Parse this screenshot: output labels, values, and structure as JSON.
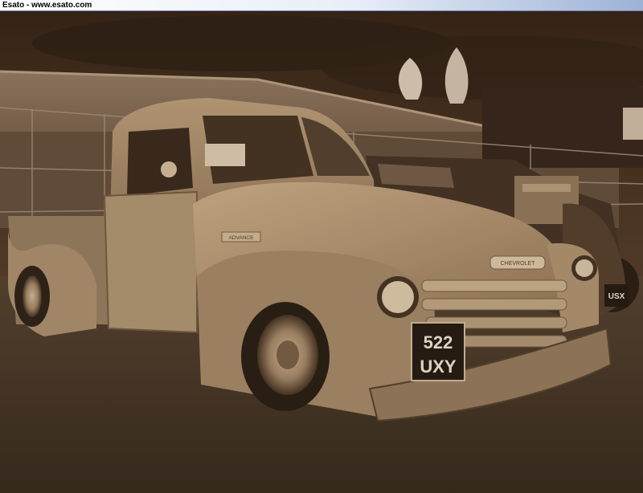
{
  "window": {
    "title": "Esato - www.esato.com"
  },
  "photo": {
    "plate_line1": "522",
    "plate_line2": "UXY",
    "rear_plate": "USX",
    "hood_emblem": "CHEVROLET",
    "side_badge": "ADVANCE",
    "tone": "#8a6a48"
  }
}
